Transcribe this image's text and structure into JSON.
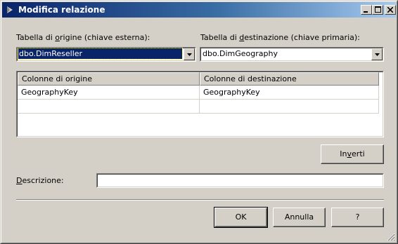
{
  "window": {
    "title": "Modifica relazione",
    "icon": "table-relation-icon",
    "controls": {
      "minimize": "minimize-icon",
      "maximize": "maximize-icon",
      "close": "close-icon"
    }
  },
  "source_table": {
    "label_pre": "Tabella di ",
    "label_accel": "o",
    "label_post": "rigine (chiave esterna):",
    "value": "dbo.DimReseller"
  },
  "dest_table": {
    "label_pre": "Tabella di ",
    "label_accel": "d",
    "label_post": "estinazione (chiave primaria):",
    "value": "dbo.DimGeography"
  },
  "columns_grid": {
    "headers": [
      "Colonne di origine",
      "Colonne di destinazione"
    ],
    "rows": [
      [
        "GeographyKey",
        "GeographyKey"
      ],
      [
        "",
        ""
      ]
    ]
  },
  "buttons": {
    "invert_pre": "In",
    "invert_accel": "v",
    "invert_post": "erti",
    "ok": "OK",
    "cancel": "Annulla",
    "help": "?"
  },
  "description": {
    "label_accel": "D",
    "label_post": "escrizione:",
    "value": ""
  },
  "colors": {
    "face": "#d4d0c8",
    "title_start": "#0a246a",
    "title_end": "#a6caf0",
    "selection": "#0a246a"
  }
}
